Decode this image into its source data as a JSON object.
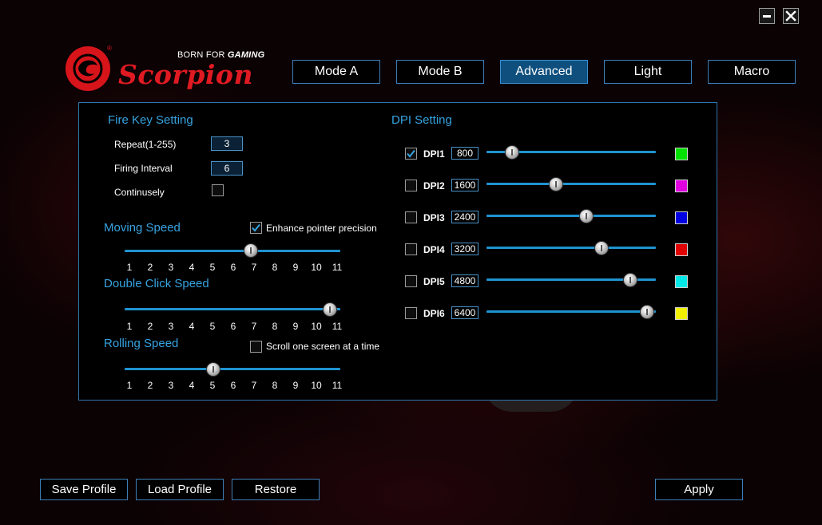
{
  "colors": {
    "accent": "#36a3e0",
    "tab_active": "#0e4f7e",
    "brand_red": "#e01a22"
  },
  "logo": {
    "tagline_prefix": "BORN FOR",
    "tagline_emph": "GAMING",
    "brand": "Scorpion",
    "reg": "®"
  },
  "tabs": [
    {
      "label": "Mode A",
      "active": false
    },
    {
      "label": "Mode B",
      "active": false
    },
    {
      "label": "Advanced",
      "active": true
    },
    {
      "label": "Light",
      "active": false
    },
    {
      "label": "Macro",
      "active": false
    }
  ],
  "fire_key": {
    "title": "Fire Key Setting",
    "repeat_label": "Repeat(1-255)",
    "repeat_value": "3",
    "interval_label": "Firing Interval",
    "interval_value": "6",
    "continuous_label": "Continusely",
    "continuous_checked": false
  },
  "moving_speed": {
    "title": "Moving Speed",
    "value": 7,
    "enhance_label": "Enhance pointer precision",
    "enhance_checked": true
  },
  "double_click_speed": {
    "title": "Double Click Speed",
    "value": 11
  },
  "rolling_speed": {
    "title": "Rolling Speed",
    "value": 5,
    "scroll_label": "Scroll one screen at a time",
    "scroll_checked": false
  },
  "ticks": [
    "1",
    "2",
    "3",
    "4",
    "5",
    "6",
    "7",
    "8",
    "9",
    "10",
    "11"
  ],
  "dpi": {
    "title": "DPI Setting",
    "rows": [
      {
        "label": "DPI1",
        "value": "800",
        "checked": true,
        "level": 0.15,
        "color": "#00e000"
      },
      {
        "label": "DPI2",
        "value": "1600",
        "checked": false,
        "level": 0.41,
        "color": "#e000e0"
      },
      {
        "label": "DPI3",
        "value": "2400",
        "checked": false,
        "level": 0.59,
        "color": "#0000e0"
      },
      {
        "label": "DPI4",
        "value": "3200",
        "checked": false,
        "level": 0.68,
        "color": "#e00000"
      },
      {
        "label": "DPI5",
        "value": "4800",
        "checked": false,
        "level": 0.85,
        "color": "#00e8e8"
      },
      {
        "label": "DPI6",
        "value": "6400",
        "checked": false,
        "level": 0.95,
        "color": "#f0f000"
      }
    ]
  },
  "buttons": {
    "save": "Save Profile",
    "load": "Load Profile",
    "restore": "Restore",
    "apply": "Apply"
  }
}
